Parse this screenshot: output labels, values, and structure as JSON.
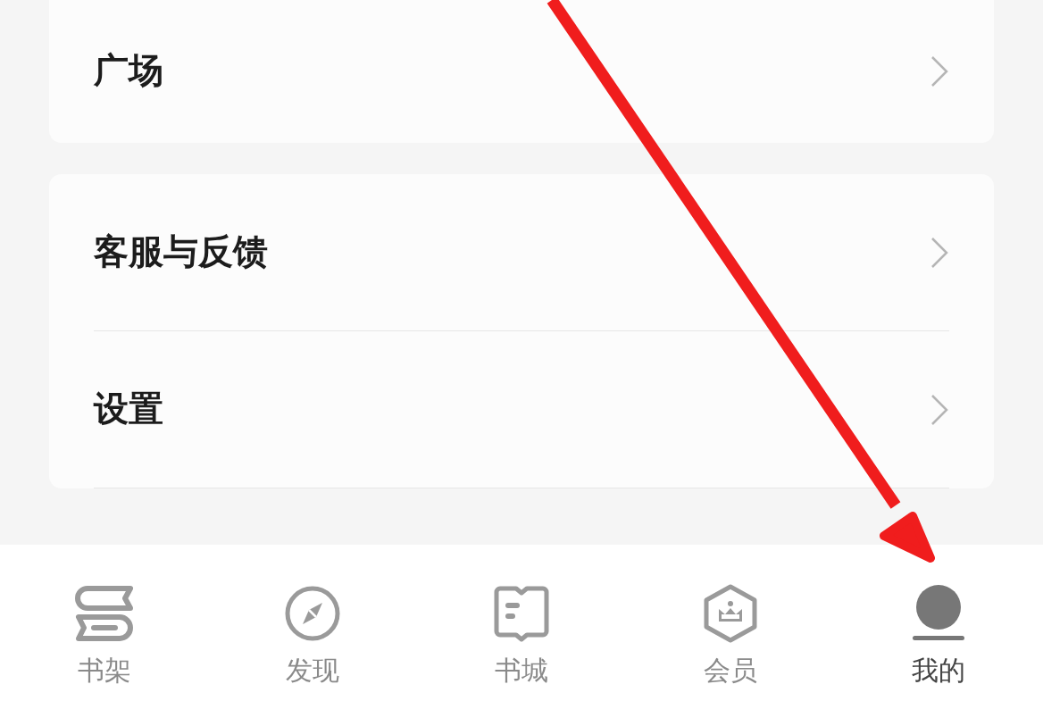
{
  "menu_groups": [
    {
      "items": [
        "广场"
      ]
    },
    {
      "items": [
        "客服与反馈",
        "设置"
      ]
    }
  ],
  "tab_bar": [
    {
      "label": "书架",
      "kind": "shelf",
      "selected": false
    },
    {
      "label": "发现",
      "kind": "compass",
      "selected": false
    },
    {
      "label": "书城",
      "kind": "book",
      "selected": false
    },
    {
      "label": "会员",
      "kind": "crown",
      "selected": false
    },
    {
      "label": "我的",
      "kind": "profile",
      "selected": true
    }
  ],
  "annotation": {
    "kind": "arrow"
  }
}
